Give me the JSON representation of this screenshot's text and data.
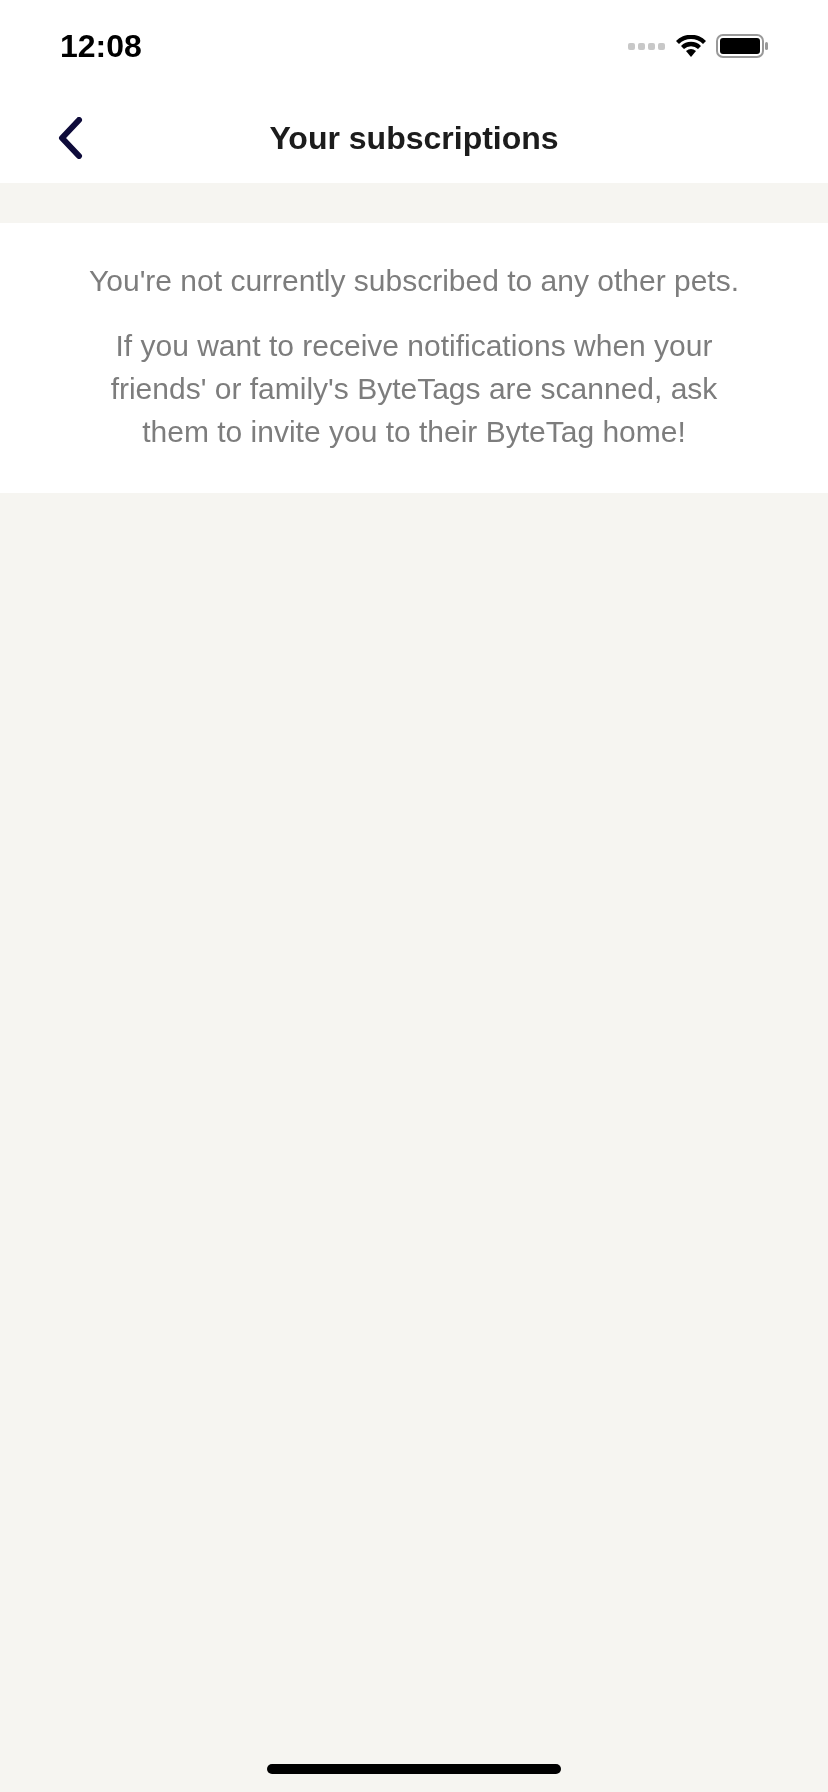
{
  "status_bar": {
    "time": "12:08"
  },
  "nav": {
    "title": "Your subscriptions"
  },
  "message": {
    "paragraphs": [
      "You're not currently subscribed to any other pets.",
      "If you want to receive notifications when your friends' or family's ByteTags are scanned, ask them to invite you to their ByteTag home!"
    ]
  }
}
